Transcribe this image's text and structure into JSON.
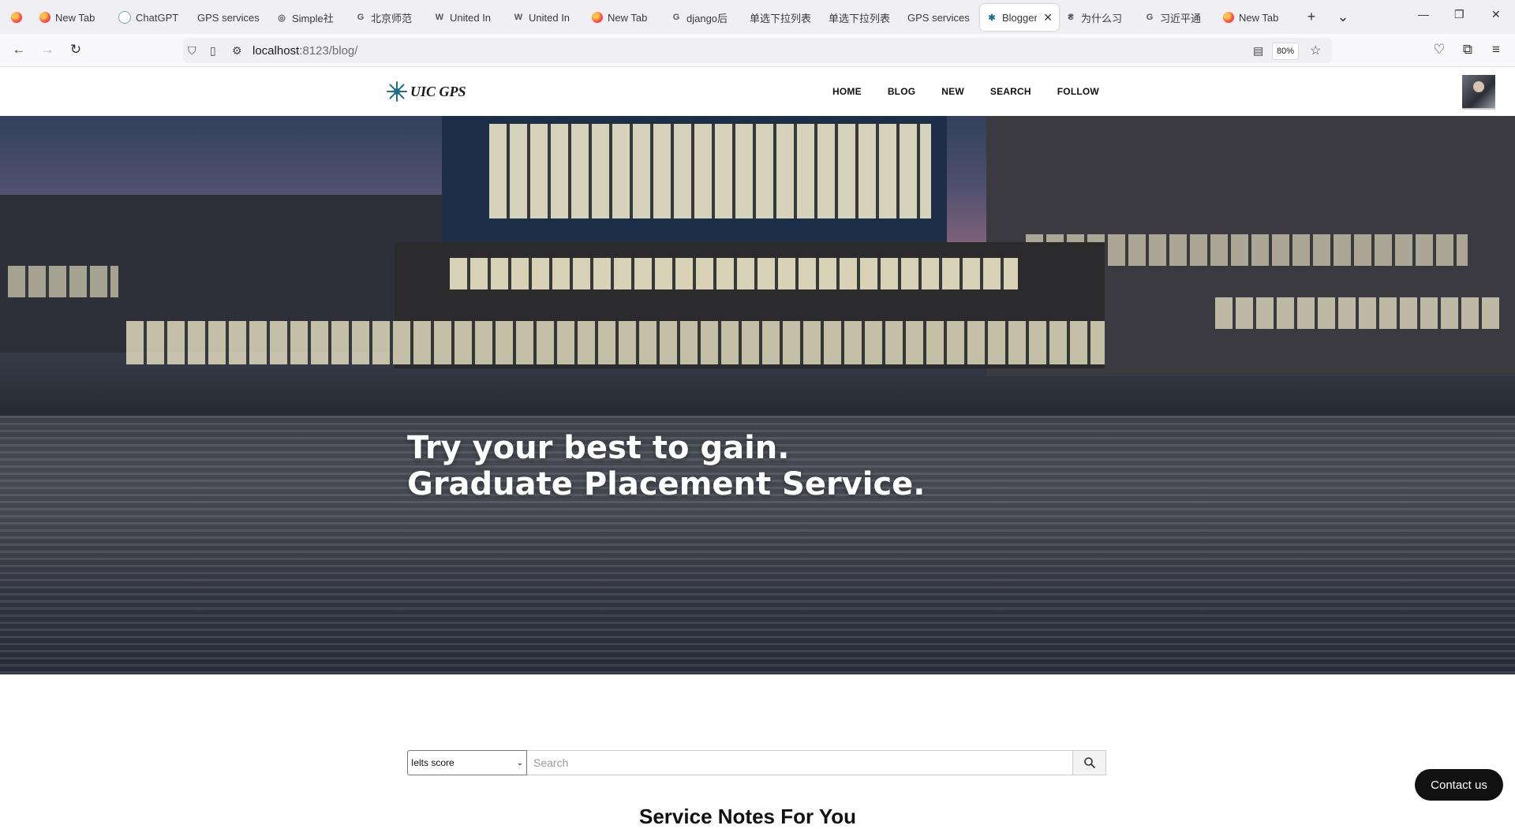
{
  "browser": {
    "tabs": [
      {
        "title": "New Tab",
        "icon": "firefox-icon"
      },
      {
        "title": "ChatGPT",
        "icon": "chatgpt-icon"
      },
      {
        "title": "GPS services",
        "icon": "none"
      },
      {
        "title": "Simple社",
        "icon": "simple-icon"
      },
      {
        "title": "北京师范",
        "icon": "google-icon"
      },
      {
        "title": "United In",
        "icon": "wikipedia-icon"
      },
      {
        "title": "United In",
        "icon": "wikipedia-icon"
      },
      {
        "title": "New Tab",
        "icon": "firefox-icon"
      },
      {
        "title": "django后",
        "icon": "google-icon"
      },
      {
        "title": "单选下拉列表",
        "icon": "none"
      },
      {
        "title": "单选下拉列表",
        "icon": "none"
      },
      {
        "title": "GPS services",
        "icon": "none"
      },
      {
        "title": "Blogger",
        "icon": "gear-icon",
        "active": true
      },
      {
        "title": "为什么习",
        "icon": "news-icon"
      },
      {
        "title": "习近平通",
        "icon": "google-icon"
      },
      {
        "title": "New Tab",
        "icon": "firefox-icon"
      }
    ],
    "url_host": "localhost",
    "url_rest": ":8123/blog/",
    "zoom": "80%"
  },
  "site": {
    "logo_text": "UIC GPS",
    "menu": [
      "HOME",
      "BLOG",
      "NEW",
      "SEARCH",
      "FOLLOW"
    ],
    "hero": {
      "line1": "Try your best to gain.",
      "line2": "Graduate Placement Service."
    },
    "search": {
      "select_value": "Ielts score",
      "placeholder": "Search"
    },
    "contact_label": "Contact us",
    "section_heading_partial": "Service Notes For You"
  }
}
